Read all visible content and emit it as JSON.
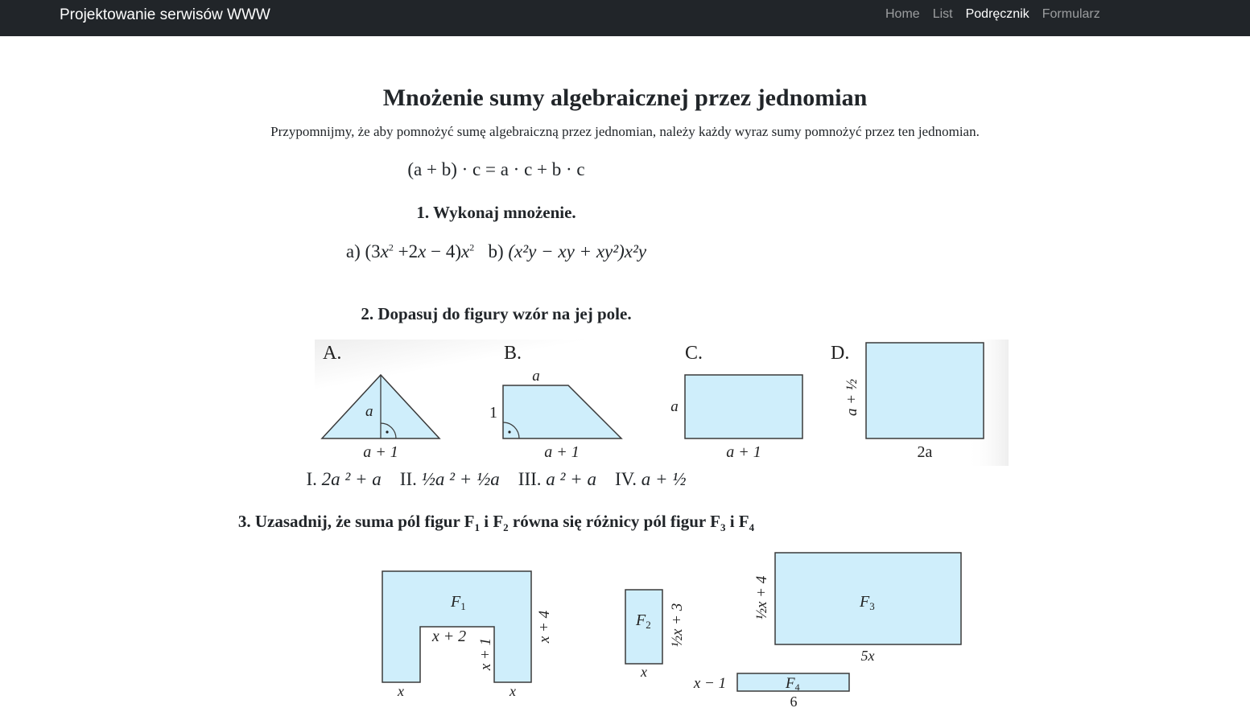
{
  "navbar": {
    "brand": "Projektowanie serwisów WWW",
    "links": [
      "Home",
      "List",
      "Podręcznik",
      "Formularz"
    ],
    "active": "Podręcznik"
  },
  "page": {
    "title": "Mnożenie sumy algebraicznej przez jednomian",
    "intro": "Przypomnijmy, że aby pomnożyć sumę algebraiczną przez jednomian, należy każdy wyraz sumy pomnożyć przez ten jednomian.",
    "formula": "(a + b) · c = a · c + b · c"
  },
  "exercise1": {
    "heading": "1. Wykonaj mnożenie.",
    "a_label": "a)",
    "a_expr": [
      "(3",
      "x",
      "2",
      " +2",
      "x",
      " − 4)",
      "x",
      "2"
    ],
    "b_label": "b)",
    "b_expr": "(x²y − xy + xy²)x²y"
  },
  "exercise2": {
    "heading": "2. Dopasuj do figury wzór na jej pole.",
    "figures": {
      "A": {
        "letter": "A.",
        "height": "a",
        "base": "a + 1"
      },
      "B": {
        "letter": "B.",
        "top": "a",
        "side": "1",
        "base": "a + 1"
      },
      "C": {
        "letter": "C.",
        "side": "a",
        "base": "a + 1"
      },
      "D": {
        "letter": "D.",
        "side": "a + ½",
        "base": "2a"
      }
    },
    "answers": [
      {
        "num": "I.",
        "expr": "2a ² + a"
      },
      {
        "num": "II.",
        "expr": "½a ² + ½a"
      },
      {
        "num": "III.",
        "expr": "a ² + a"
      },
      {
        "num": "IV.",
        "expr": "a + ½"
      }
    ]
  },
  "exercise3": {
    "heading_parts": [
      "3. Uzasadnij, że suma pól figur F",
      "1",
      " i F",
      "2",
      " równa się różnicy pól figur F",
      "3",
      " i F",
      "4"
    ],
    "F1": {
      "name": "F",
      "sub": "1",
      "inner_top": "x + 2",
      "inner_side": "x + 1",
      "right": "x + 4",
      "bottom_left": "x",
      "bottom_right": "x"
    },
    "F2": {
      "name": "F",
      "sub": "2",
      "side": "½x + 3",
      "bottom": "x"
    },
    "F3": {
      "name": "F",
      "sub": "3",
      "side": "½x + 4",
      "bottom": "5x"
    },
    "F4": {
      "name": "F",
      "sub": "4",
      "side": "x − 1",
      "bottom": "6"
    }
  },
  "colors": {
    "navbar": "#212529",
    "figure_fill": "#cfeefb",
    "figure_stroke": "#3a3a3a"
  }
}
